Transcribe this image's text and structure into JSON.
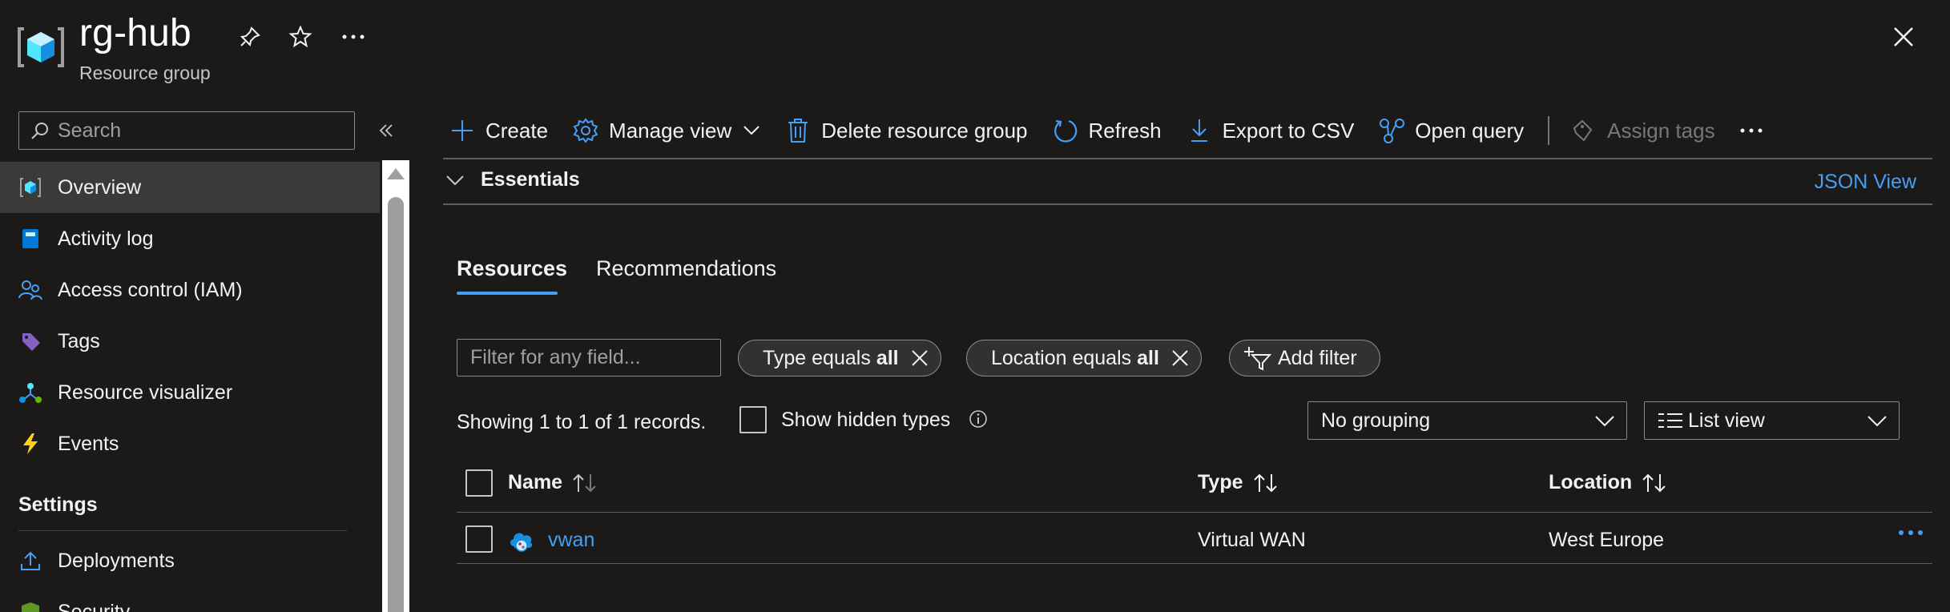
{
  "header": {
    "title": "rg-hub",
    "subtitle": "Resource group"
  },
  "sidebar": {
    "search_placeholder": "Search",
    "items": [
      {
        "label": "Overview",
        "icon": "resource-group-icon"
      },
      {
        "label": "Activity log",
        "icon": "activity-log-icon"
      },
      {
        "label": "Access control (IAM)",
        "icon": "people-icon"
      },
      {
        "label": "Tags",
        "icon": "tag-icon"
      },
      {
        "label": "Resource visualizer",
        "icon": "visualizer-icon"
      },
      {
        "label": "Events",
        "icon": "lightning-icon"
      }
    ],
    "section_settings": "Settings",
    "settings_items": [
      {
        "label": "Deployments",
        "icon": "deploy-icon"
      },
      {
        "label": "Security",
        "icon": "shield-icon"
      }
    ]
  },
  "toolbar": {
    "create": "Create",
    "manage_view": "Manage view",
    "delete": "Delete resource group",
    "refresh": "Refresh",
    "export": "Export to CSV",
    "open_query": "Open query",
    "assign_tags": "Assign tags"
  },
  "essentials": {
    "label": "Essentials",
    "json_view": "JSON View"
  },
  "tabs": [
    "Resources",
    "Recommendations"
  ],
  "filters": {
    "placeholder": "Filter for any field...",
    "type_label": "Type equals",
    "type_value": "all",
    "location_label": "Location equals",
    "location_value": "all",
    "add": "Add filter"
  },
  "records": "Showing 1 to 1 of 1 records.",
  "show_hidden": "Show hidden types",
  "grouping": "No grouping",
  "view": "List view",
  "table": {
    "columns": [
      "Name",
      "Type",
      "Location"
    ],
    "rows": [
      {
        "name": "vwan",
        "type": "Virtual WAN",
        "location": "West Europe"
      }
    ]
  },
  "colors": {
    "background": "#1b1a19",
    "accent": "#479ef5",
    "selected": "#3b3a39"
  }
}
